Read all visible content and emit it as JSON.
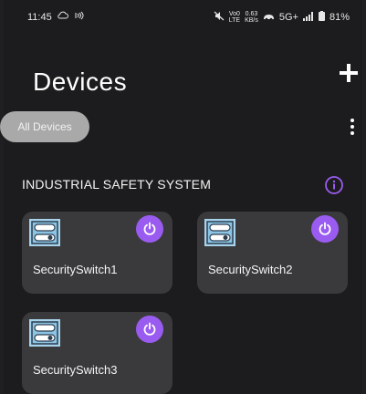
{
  "status_bar": {
    "time": "11:45",
    "network_speed_value": "0.63",
    "network_speed_unit": "KB/s",
    "volte_top": "Vo0",
    "volte_bottom": "LTE",
    "network_type": "5G+",
    "battery": "81%"
  },
  "header": {
    "title": "Devices",
    "add_icon": "plus-icon"
  },
  "filter": {
    "selected": "All Devices",
    "menu_icon": "more-vertical-icon"
  },
  "section": {
    "title": "INDUSTRIAL SAFETY SYSTEM",
    "info_icon": "info-icon"
  },
  "devices": [
    {
      "name": "SecuritySwitch1",
      "icon": "switch-device-icon",
      "power_icon": "power-icon"
    },
    {
      "name": "SecuritySwitch2",
      "icon": "switch-device-icon",
      "power_icon": "power-icon"
    },
    {
      "name": "SecuritySwitch3",
      "icon": "switch-device-icon",
      "power_icon": "power-icon"
    }
  ],
  "colors": {
    "background": "#1c1c1e",
    "card": "#3a3a3c",
    "accent": "#9a5cf0",
    "chip": "#a9a9a9"
  }
}
